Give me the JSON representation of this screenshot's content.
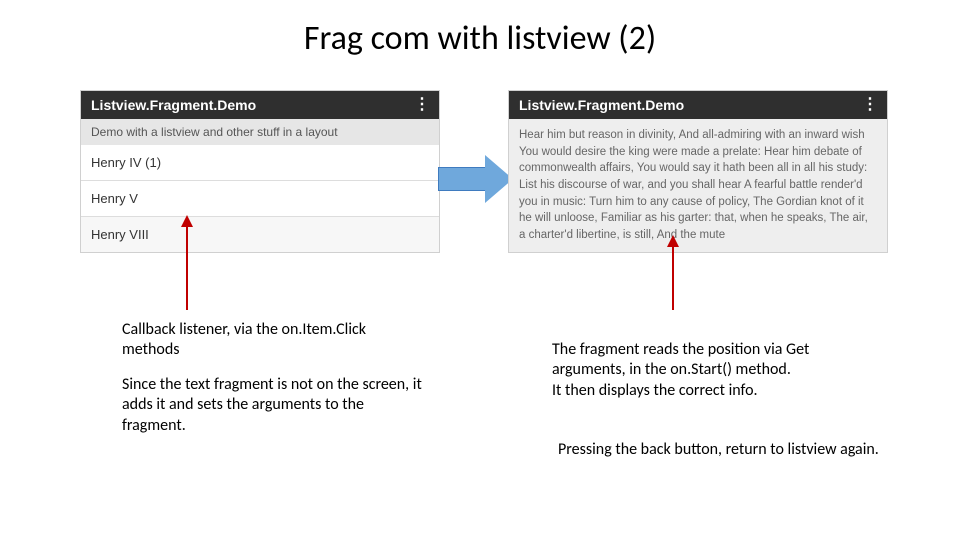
{
  "title": "Frag com with listview (2)",
  "phone_left": {
    "appbar_title": "Listview.Fragment.Demo",
    "overflow_glyph": "⋮",
    "subtitle": "Demo with a listview and other stuff in a layout",
    "rows": [
      "Henry IV (1)",
      "Henry V",
      "Henry VIII"
    ]
  },
  "phone_right": {
    "appbar_title": "Listview.Fragment.Demo",
    "overflow_glyph": "⋮",
    "body": "Hear him but reason in divinity, And all-admiring with an inward wish You would desire the king were made a prelate: Hear him debate of commonwealth affairs, You would say it hath been all in all his study: List his discourse of war, and you shall hear A fearful battle render'd you in music: Turn him to any cause of policy, The Gordian knot of it he will unloose, Familiar as his garter: that, when he speaks, The air, a charter'd libertine, is still, And the mute"
  },
  "captions": {
    "left_p1": "Callback listener, via the on.Item.Click methods",
    "left_p2": "Since the text fragment is not on the screen, it adds it and sets the arguments to the fragment.",
    "right_p1": "The fragment reads the position via Get arguments, in the on.Start() method.\nIt then displays the correct info.",
    "right_p2": "Pressing the back button, return to listview again."
  }
}
